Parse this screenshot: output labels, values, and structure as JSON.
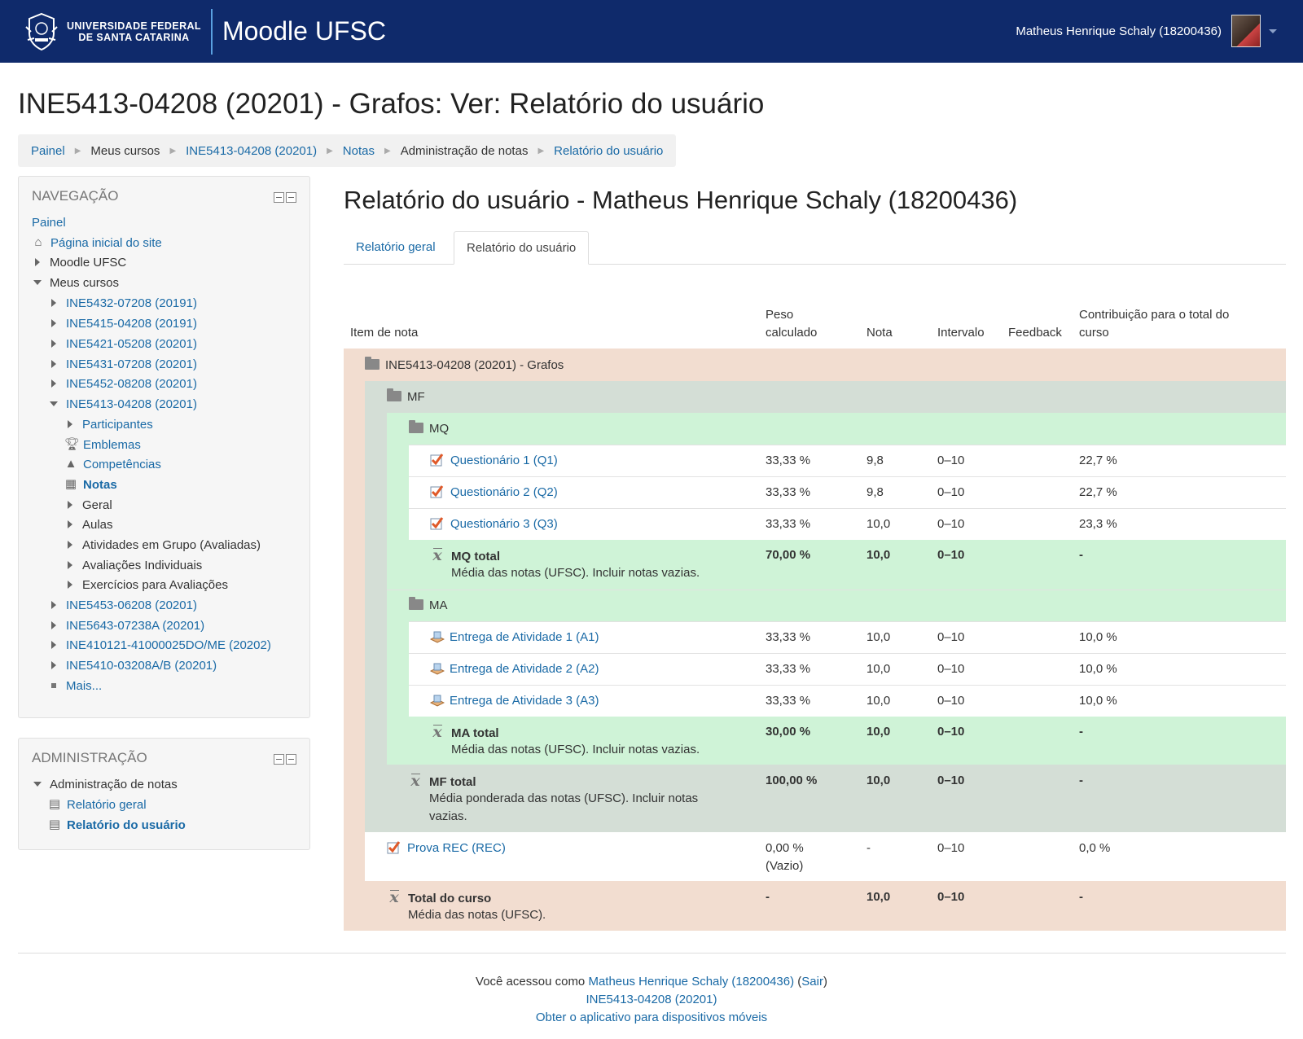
{
  "header": {
    "university_line1": "UNIVERSIDADE FEDERAL",
    "university_line2": "DE SANTA CATARINA",
    "site_name": "Moodle UFSC",
    "user_name": "Matheus Henrique Schaly (18200436)"
  },
  "page_title": "INE5413-04208 (20201) - Grafos: Ver: Relatório do usuário",
  "breadcrumb": [
    "Painel",
    "Meus cursos",
    "INE5413-04208 (20201)",
    "Notas",
    "Administração de notas",
    "Relatório do usuário"
  ],
  "navigation": {
    "title": "NAVEGAÇÃO",
    "painel": "Painel",
    "home": "Página inicial do site",
    "moodle_ufsc": "Moodle UFSC",
    "my_courses": "Meus cursos",
    "courses": [
      "INE5432-07208 (20191)",
      "INE5415-04208 (20191)",
      "INE5421-05208 (20201)",
      "INE5431-07208 (20201)",
      "INE5452-08208 (20201)",
      "INE5413-04208 (20201)"
    ],
    "course_children": [
      "Participantes",
      "Emblemas",
      "Competências",
      "Notas",
      "Geral",
      "Aulas",
      "Atividades em Grupo (Avaliadas)",
      "Avaliações Individuais",
      "Exercícios para Avaliações"
    ],
    "more_courses": [
      "INE5453-06208 (20201)",
      "INE5643-07238A (20201)",
      "INE410121-41000025DO/ME (20202)",
      "INE5410-03208A/B (20201)"
    ],
    "more": "Mais..."
  },
  "administration": {
    "title": "ADMINISTRAÇÃO",
    "section": "Administração de notas",
    "items": [
      "Relatório geral",
      "Relatório do usuário"
    ]
  },
  "report": {
    "title": "Relatório do usuário - Matheus Henrique Schaly (18200436)",
    "tabs": [
      "Relatório geral",
      "Relatório do usuário"
    ],
    "columns": {
      "item": "Item de nota",
      "weight_1": "Peso",
      "weight_2": "calculado",
      "grade": "Nota",
      "range": "Intervalo",
      "feedback": "Feedback",
      "contribution_1": "Contribuição para o total do",
      "contribution_2": "curso"
    },
    "course_category": "INE5413-04208 (20201) - Grafos",
    "mf": "MF",
    "mq": "MQ",
    "ma": "MA",
    "quizzes": [
      {
        "name": "Questionário 1 (Q1)",
        "weight": "33,33 %",
        "grade": "9,8",
        "range": "0–10",
        "contribution": "22,7 %"
      },
      {
        "name": "Questionário 2 (Q2)",
        "weight": "33,33 %",
        "grade": "9,8",
        "range": "0–10",
        "contribution": "22,7 %"
      },
      {
        "name": "Questionário 3 (Q3)",
        "weight": "33,33 %",
        "grade": "10,0",
        "range": "0–10",
        "contribution": "23,3 %"
      }
    ],
    "mq_total": {
      "name": "MQ total",
      "desc": "Média das notas (UFSC). Incluir notas vazias.",
      "weight": "70,00 %",
      "grade": "10,0",
      "range": "0–10",
      "contribution": "-"
    },
    "assignments": [
      {
        "name": "Entrega de Atividade 1 (A1)",
        "weight": "33,33 %",
        "grade": "10,0",
        "range": "0–10",
        "contribution": "10,0 %"
      },
      {
        "name": "Entrega de Atividade 2 (A2)",
        "weight": "33,33 %",
        "grade": "10,0",
        "range": "0–10",
        "contribution": "10,0 %"
      },
      {
        "name": "Entrega de Atividade 3 (A3)",
        "weight": "33,33 %",
        "grade": "10,0",
        "range": "0–10",
        "contribution": "10,0 %"
      }
    ],
    "ma_total": {
      "name": "MA total",
      "desc": "Média das notas (UFSC). Incluir notas vazias.",
      "weight": "30,00 %",
      "grade": "10,0",
      "range": "0–10",
      "contribution": "-"
    },
    "mf_total": {
      "name": "MF total",
      "desc_1": "Média ponderada das notas (UFSC). Incluir notas",
      "desc_2": "vazias.",
      "weight": "100,00 %",
      "grade": "10,0",
      "range": "0–10",
      "contribution": "-"
    },
    "rec": {
      "name": "Prova REC (REC)",
      "weight": "0,00 %",
      "weight_note": "(Vazio)",
      "grade": "-",
      "range": "0–10",
      "contribution": "0,0 %"
    },
    "course_total": {
      "name": "Total do curso",
      "desc": "Média das notas (UFSC).",
      "weight": "-",
      "grade": "10,0",
      "range": "0–10",
      "contribution": "-"
    }
  },
  "footer": {
    "logged_as": "Você acessou como",
    "user_link": "Matheus Henrique Schaly (18200436)",
    "logout": "Sair",
    "course_link": "INE5413-04208 (20201)",
    "app_link": "Obter o aplicativo para dispositivos móveis"
  },
  "colors": {
    "header_bg": "#0f2a6b",
    "link": "#1a6aa6",
    "course_band": "#f2ddd0",
    "mf_band": "#d4ded6",
    "mq_band": "#cff3d7"
  }
}
